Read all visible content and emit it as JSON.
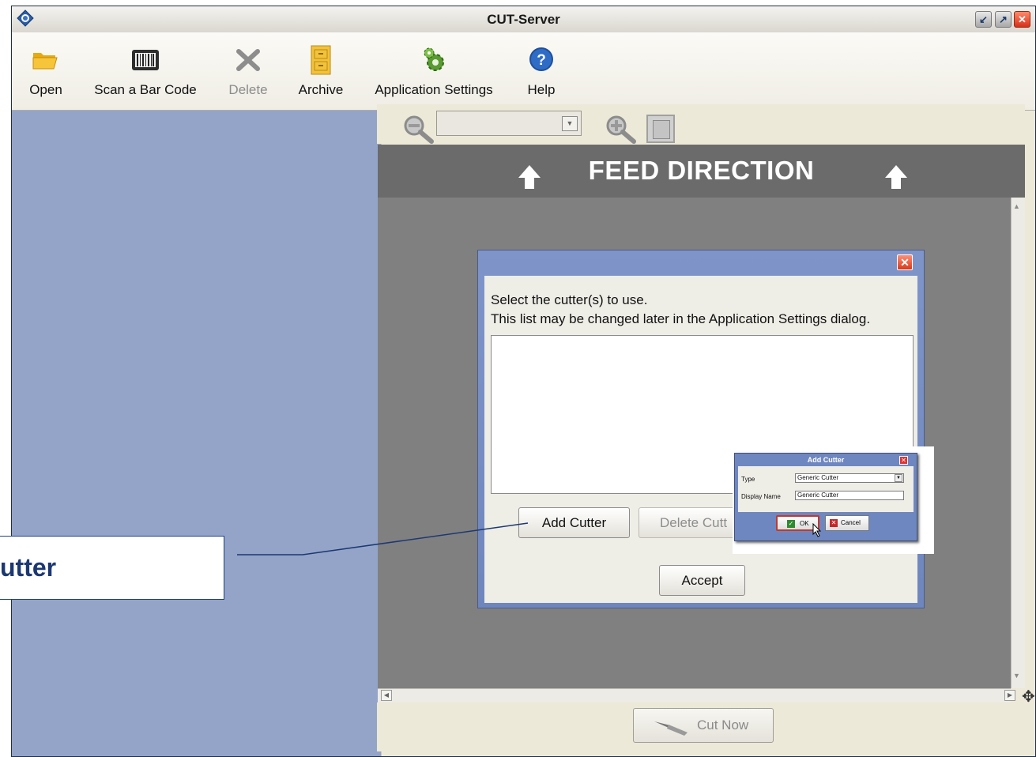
{
  "window": {
    "title": "CUT-Server",
    "controls": [
      "minimize-icon",
      "maximize-icon",
      "close-icon"
    ]
  },
  "toolbar": {
    "items": [
      {
        "label": "Open",
        "icon": "folder-open-icon",
        "enabled": true
      },
      {
        "label": "Scan a Bar Code",
        "icon": "barcode-icon",
        "enabled": true
      },
      {
        "label": "Delete",
        "icon": "delete-x-icon",
        "enabled": false
      },
      {
        "label": "Archive",
        "icon": "archive-cabinet-icon",
        "enabled": true
      },
      {
        "label": "Application Settings",
        "icon": "gear-settings-icon",
        "enabled": true
      },
      {
        "label": "Help",
        "icon": "help-icon",
        "enabled": true
      }
    ]
  },
  "zoom": {
    "zoom_out_icon": "zoom-out-icon",
    "zoom_in_icon": "zoom-in-icon",
    "fit_icon": "fit-page-icon",
    "selected": ""
  },
  "feed": {
    "label": "FEED DIRECTION",
    "arrow_icon": "up-arrow-icon"
  },
  "bottom": {
    "cut_now_label": "Cut Now"
  },
  "dialog": {
    "line1": "Select the cutter(s) to use.",
    "line2": "This list may be changed later in the Application Settings dialog.",
    "cutters": [],
    "add_label": "Add Cutter",
    "delete_label": "Delete Cutt",
    "accept_label": "Accept"
  },
  "add_cutter_dialog": {
    "title": "Add Cutter",
    "type_label": "Type",
    "type_value": "Generic Cutter",
    "name_label": "Display Name",
    "name_value": "Generic Cutter",
    "ok_label": "OK",
    "cancel_label": "Cancel"
  },
  "callout": {
    "text": "utter"
  },
  "colors": {
    "left_panel": "#94a4c8",
    "canvas": "#808080",
    "feed_bar": "#6b6b6b",
    "callout_text": "#1c3872"
  }
}
